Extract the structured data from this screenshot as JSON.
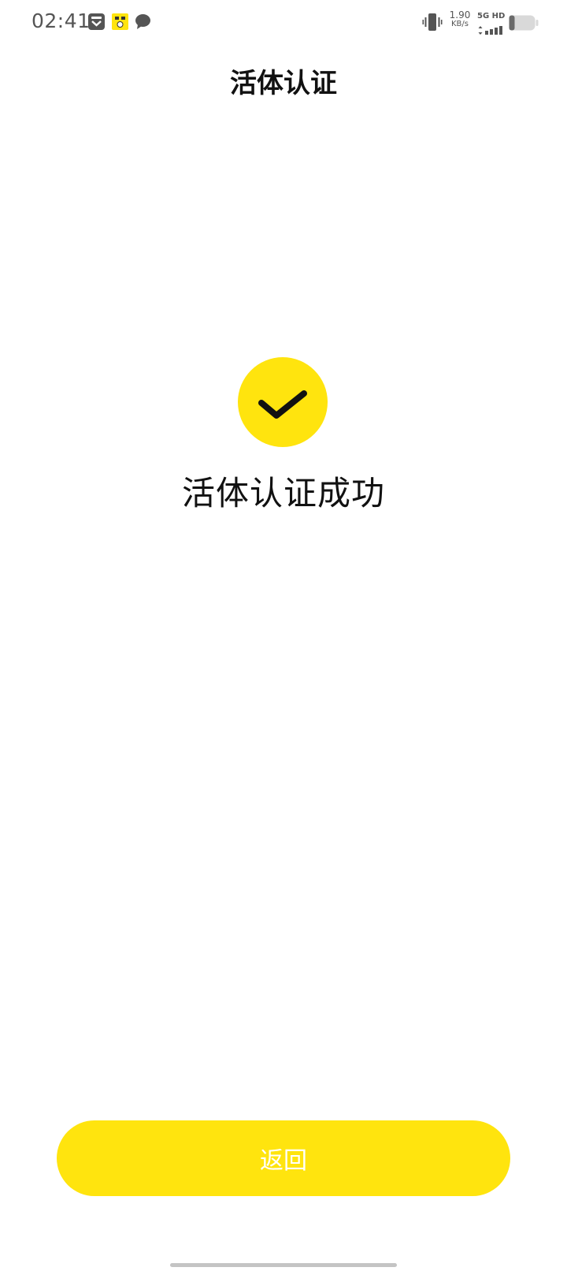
{
  "status_bar": {
    "time": "02:41",
    "speed_value": "1.90",
    "speed_unit": "KB/s",
    "network": "5G HD",
    "icons": [
      "inbox-icon",
      "app-badge-icon",
      "message-icon",
      "vibrate-icon",
      "signal-icon",
      "battery-icon"
    ]
  },
  "header": {
    "title": "活体认证"
  },
  "result": {
    "icon": "check-icon",
    "message": "活体认证成功"
  },
  "footer": {
    "back_label": "返回"
  },
  "colors": {
    "accent": "#ffe40e",
    "text": "#111111",
    "status_gray": "#555555",
    "button_text": "#ffffff"
  }
}
